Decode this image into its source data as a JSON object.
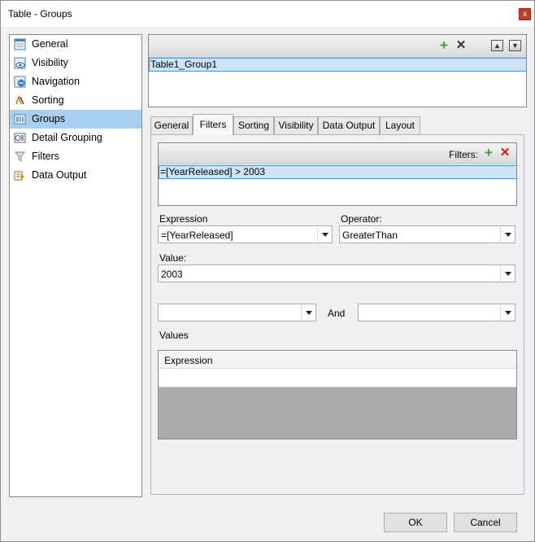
{
  "window": {
    "title": "Table - Groups",
    "close_glyph": "x"
  },
  "nav": {
    "items": [
      {
        "label": "General",
        "icon": "general-icon",
        "selected": false
      },
      {
        "label": "Visibility",
        "icon": "visibility-icon",
        "selected": false
      },
      {
        "label": "Navigation",
        "icon": "navigation-icon",
        "selected": false
      },
      {
        "label": "Sorting",
        "icon": "sorting-icon",
        "selected": false
      },
      {
        "label": "Groups",
        "icon": "groups-icon",
        "selected": true
      },
      {
        "label": "Detail Grouping",
        "icon": "detail-grouping-icon",
        "selected": false
      },
      {
        "label": "Filters",
        "icon": "filters-icon",
        "selected": false
      },
      {
        "label": "Data Output",
        "icon": "data-output-icon",
        "selected": false
      }
    ]
  },
  "groups": {
    "items": [
      "Table1_Group1"
    ],
    "selected_index": 0,
    "toolbar": {
      "add_icon": "add-icon",
      "delete_icon": "delete-icon",
      "move_up_icon": "move-up-icon",
      "move_down_icon": "move-down-icon"
    }
  },
  "tabs": {
    "items": [
      "General",
      "Filters",
      "Sorting",
      "Visibility",
      "Data Output",
      "Layout"
    ],
    "active": "Filters"
  },
  "filters": {
    "label": "Filters:",
    "items": [
      "=[YearReleased] > 2003"
    ],
    "selected_index": 0
  },
  "form": {
    "expression_label": "Expression",
    "expression_value": "=[YearReleased]",
    "operator_label": "Operator:",
    "operator_value": "GreaterThan",
    "value_label": "Value:",
    "value_value": "2003",
    "range_from_value": "",
    "range_and_label": "And",
    "range_to_value": ""
  },
  "values_grid": {
    "label": "Values",
    "column_header": "Expression",
    "rows": [
      ""
    ]
  },
  "buttons": {
    "ok": "OK",
    "cancel": "Cancel"
  },
  "colors": {
    "selection_fill": "#a8cfee",
    "row_selection_fill": "#cde4f8",
    "row_selection_border": "#3399ff",
    "add_green": "#2eaa2e",
    "delete_red": "#e01010",
    "close_red": "#c0392b"
  }
}
